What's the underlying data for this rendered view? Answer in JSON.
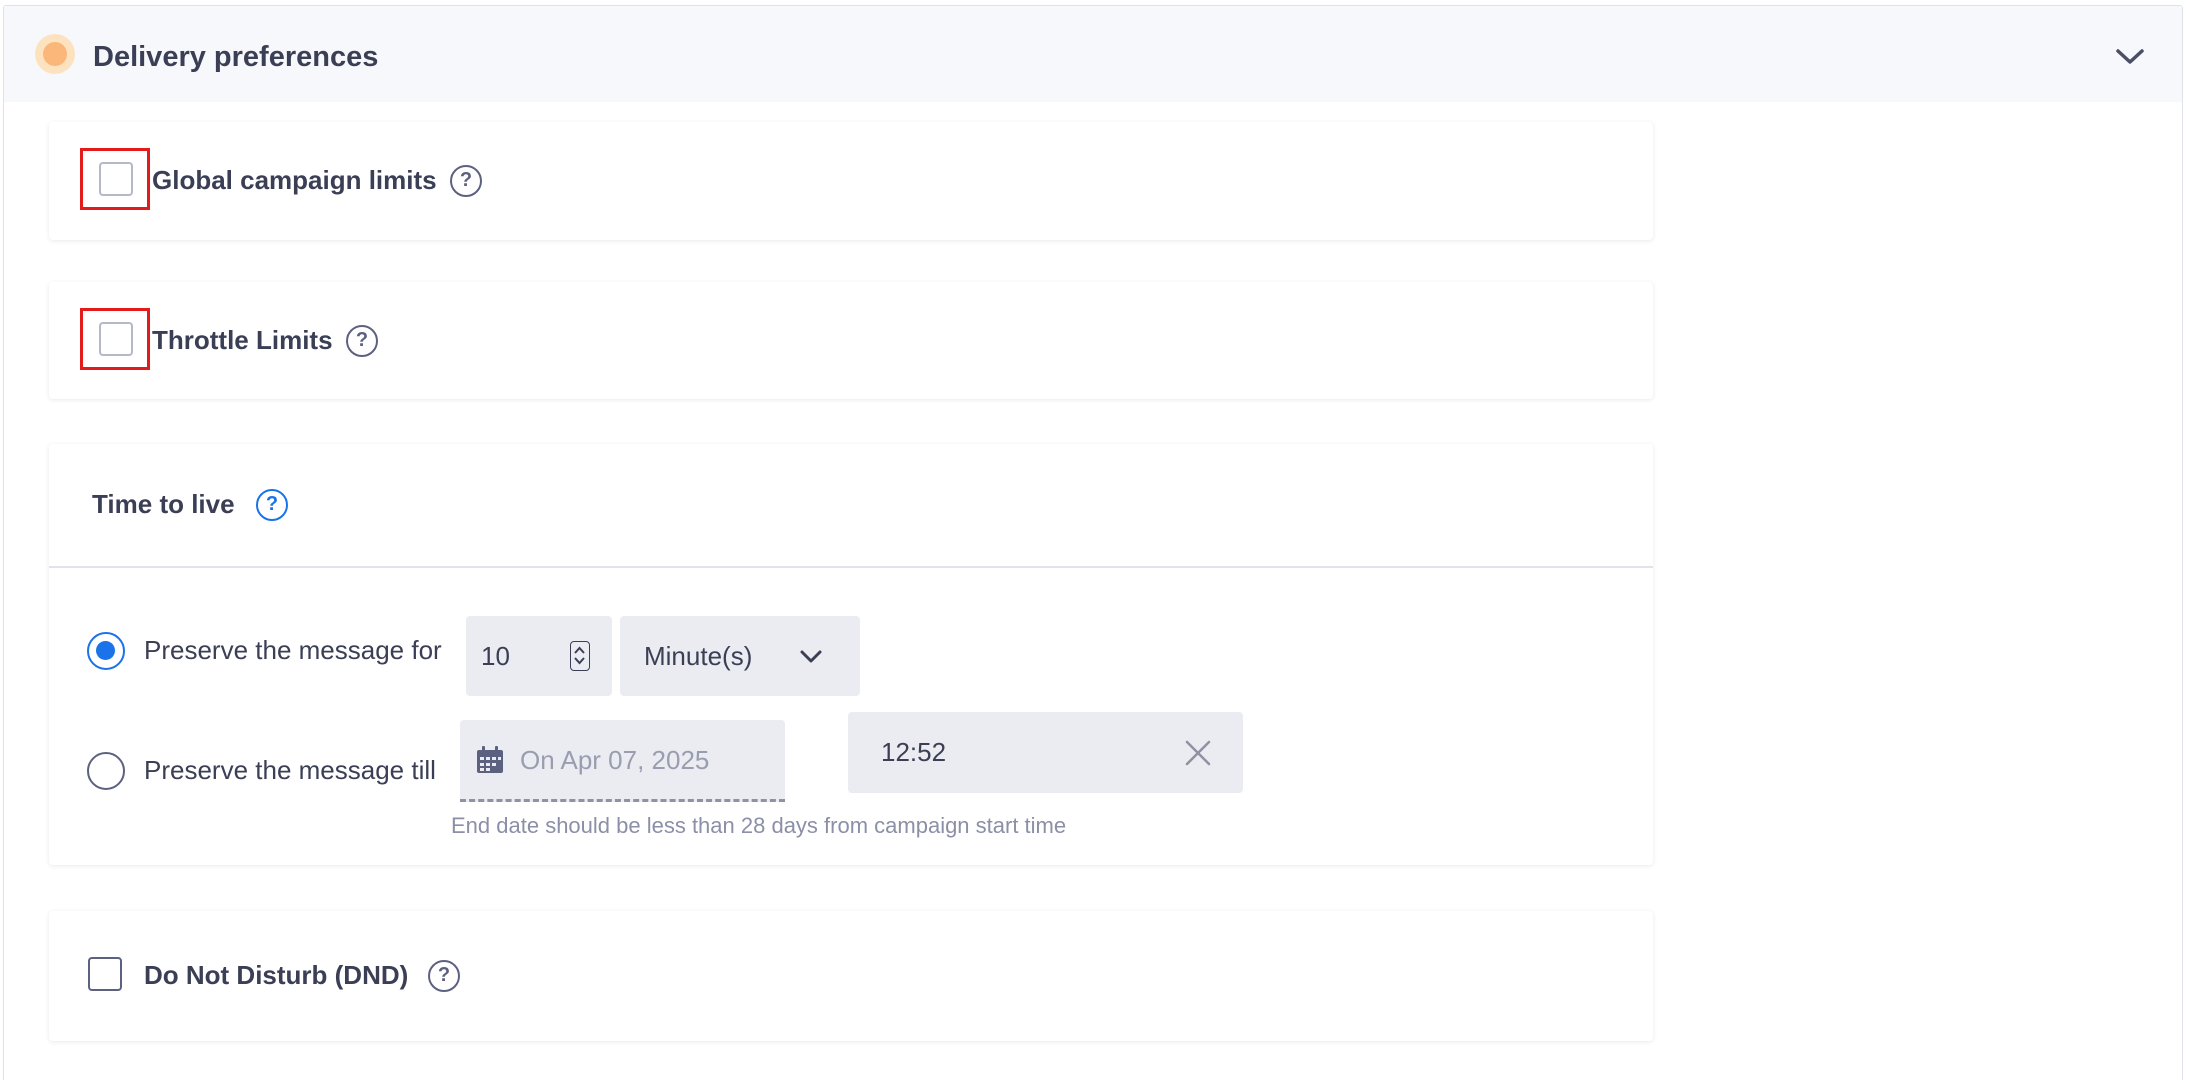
{
  "section": {
    "title": "Delivery preferences",
    "status_icon": "status-dot-icon",
    "collapse_icon": "chevron-down-icon"
  },
  "global_limits": {
    "label": "Global campaign limits",
    "checked": false,
    "help_icon": "help-icon"
  },
  "throttle_limits": {
    "label": "Throttle Limits",
    "checked": false,
    "help_icon": "help-icon"
  },
  "ttl": {
    "title": "Time to live",
    "preserve_for": {
      "label": "Preserve the message for",
      "selected": true,
      "value": "10",
      "unit": "Minute(s)"
    },
    "preserve_till": {
      "label": "Preserve the message till",
      "selected": false,
      "date_placeholder": "On Apr 07, 2025",
      "time_value": "12:52",
      "hint": "End date should be less than 28 days from campaign start time"
    }
  },
  "dnd": {
    "label": "Do Not Disturb (DND)",
    "checked": false,
    "help_icon": "help-icon"
  },
  "colors": {
    "accent": "#1a73e8",
    "highlight": "#e31b1b",
    "header_bg": "#f7f8fb",
    "field_bg": "#ebecf1",
    "status_dot": "#fbb77a"
  }
}
